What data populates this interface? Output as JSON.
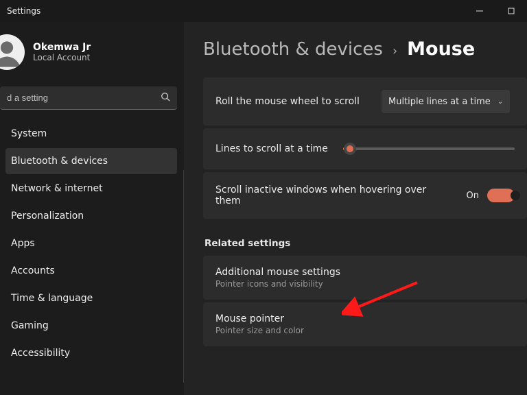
{
  "window": {
    "title": "Settings"
  },
  "profile": {
    "name": "Okemwa Jr",
    "account_type": "Local Account"
  },
  "search": {
    "placeholder": "d a setting"
  },
  "nav": {
    "items": [
      {
        "label": "System"
      },
      {
        "label": "Bluetooth & devices"
      },
      {
        "label": "Network & internet"
      },
      {
        "label": "Personalization"
      },
      {
        "label": "Apps"
      },
      {
        "label": "Accounts"
      },
      {
        "label": "Time & language"
      },
      {
        "label": "Gaming"
      },
      {
        "label": "Accessibility"
      }
    ],
    "active_index": 1
  },
  "breadcrumb": {
    "parent": "Bluetooth & devices",
    "leaf": "Mouse"
  },
  "settings": {
    "roll_wheel": {
      "label": "Roll the mouse wheel to scroll",
      "value": "Multiple lines at a time"
    },
    "lines": {
      "label": "Lines to scroll at a time"
    },
    "scroll_inactive": {
      "label": "Scroll inactive windows when hovering over them",
      "state": "On",
      "on": true
    }
  },
  "related": {
    "heading": "Related settings",
    "items": [
      {
        "title": "Additional mouse settings",
        "sub": "Pointer icons and visibility"
      },
      {
        "title": "Mouse pointer",
        "sub": "Pointer size and color"
      }
    ]
  },
  "accent": "#e07055"
}
